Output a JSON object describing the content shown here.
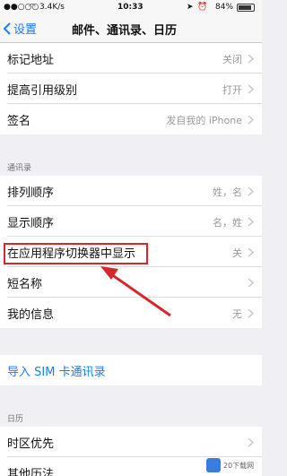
{
  "status": {
    "signal": "●●○○○",
    "network": "3.4K/s",
    "time": "10:33",
    "battery": "84%"
  },
  "nav": {
    "back_label": "设置",
    "title": "邮件、通讯录、日历"
  },
  "mail_rows": [
    {
      "label": "标记地址",
      "value": "关闭"
    },
    {
      "label": "提高引用级别",
      "value": "打开"
    },
    {
      "label": "签名",
      "value": "发自我的 iPhone"
    }
  ],
  "contacts_header": "通讯录",
  "contacts_rows": [
    {
      "label": "排列顺序",
      "value": "姓，名"
    },
    {
      "label": "显示顺序",
      "value": "名，姓"
    },
    {
      "label": "在应用程序切换器中显示",
      "value": "关"
    },
    {
      "label": "短名称",
      "value": ""
    },
    {
      "label": "我的信息",
      "value": "无"
    }
  ],
  "import_label": "导入 SIM 卡通讯录",
  "calendar_header": "日历",
  "calendar_rows": [
    {
      "label": "时区优先",
      "value": ""
    },
    {
      "label": "其他历法",
      "value": ""
    }
  ],
  "watermark": "20下载网",
  "colors": {
    "accent": "#1a7cf5",
    "highlight": "#d8262a"
  }
}
